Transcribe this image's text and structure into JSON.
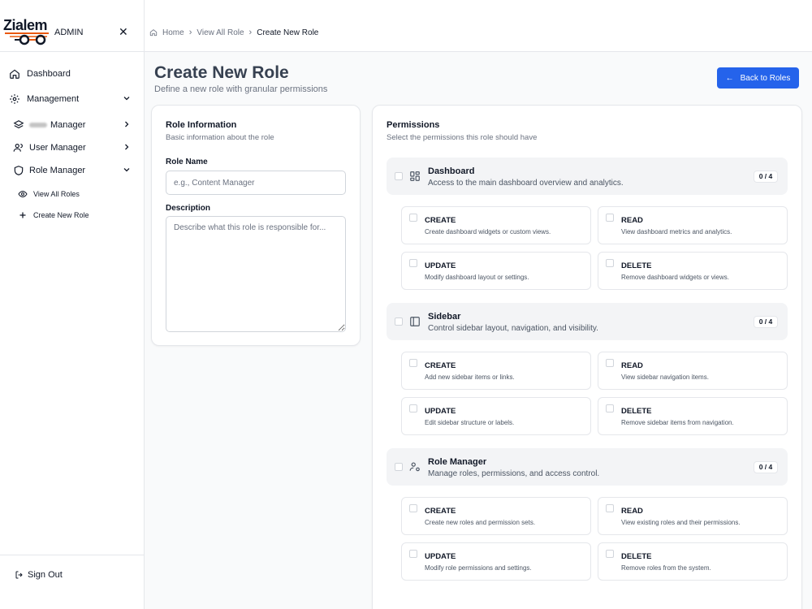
{
  "brand": {
    "logo_text": "Zialem",
    "role_label": "ADMIN"
  },
  "sidebar": {
    "items": [
      {
        "label": "Dashboard"
      },
      {
        "label": "Management"
      },
      {
        "label": "Manager"
      },
      {
        "label": "User Manager"
      },
      {
        "label": "Role Manager"
      },
      {
        "label": "View All Roles"
      },
      {
        "label": "Create New Role"
      }
    ],
    "sign_out": "Sign Out"
  },
  "breadcrumb": [
    "Home",
    "View All Role",
    "Create New Role"
  ],
  "page": {
    "title": "Create New Role",
    "subtitle": "Define a new role with granular permissions",
    "back_button": "Back to Roles"
  },
  "role_info": {
    "title": "Role Information",
    "subtitle": "Basic information about the role",
    "name_label": "Role Name",
    "name_placeholder": "e.g., Content Manager",
    "name_value": "",
    "description_label": "Description",
    "description_placeholder": "Describe what this role is responsible for...",
    "description_value": ""
  },
  "permissions": {
    "title": "Permissions",
    "subtitle": "Select the permissions this role should have",
    "groups": [
      {
        "name": "Dashboard",
        "description": "Access to the main dashboard overview and analytics.",
        "count": "0 / 4",
        "icon": "layout-grid-icon",
        "perms": [
          {
            "name": "CREATE",
            "description": "Create dashboard widgets or custom views."
          },
          {
            "name": "READ",
            "description": "View dashboard metrics and analytics."
          },
          {
            "name": "UPDATE",
            "description": "Modify dashboard layout or settings."
          },
          {
            "name": "DELETE",
            "description": "Remove dashboard widgets or views."
          }
        ]
      },
      {
        "name": "Sidebar",
        "description": "Control sidebar layout, navigation, and visibility.",
        "count": "0 / 4",
        "icon": "panel-left-icon",
        "perms": [
          {
            "name": "CREATE",
            "description": "Add new sidebar items or links."
          },
          {
            "name": "READ",
            "description": "View sidebar navigation items."
          },
          {
            "name": "UPDATE",
            "description": "Edit sidebar structure or labels."
          },
          {
            "name": "DELETE",
            "description": "Remove sidebar items from navigation."
          }
        ]
      },
      {
        "name": "Role Manager",
        "description": "Manage roles, permissions, and access control.",
        "count": "0 / 4",
        "icon": "user-cog-icon",
        "perms": [
          {
            "name": "CREATE",
            "description": "Create new roles and permission sets."
          },
          {
            "name": "READ",
            "description": "View existing roles and their permissions."
          },
          {
            "name": "UPDATE",
            "description": "Modify role permissions and settings."
          },
          {
            "name": "DELETE",
            "description": "Remove roles from the system."
          }
        ]
      }
    ]
  },
  "colors": {
    "primary": "#2563eb",
    "logo_accent": "#ea580c",
    "border": "#e5e7eb"
  }
}
